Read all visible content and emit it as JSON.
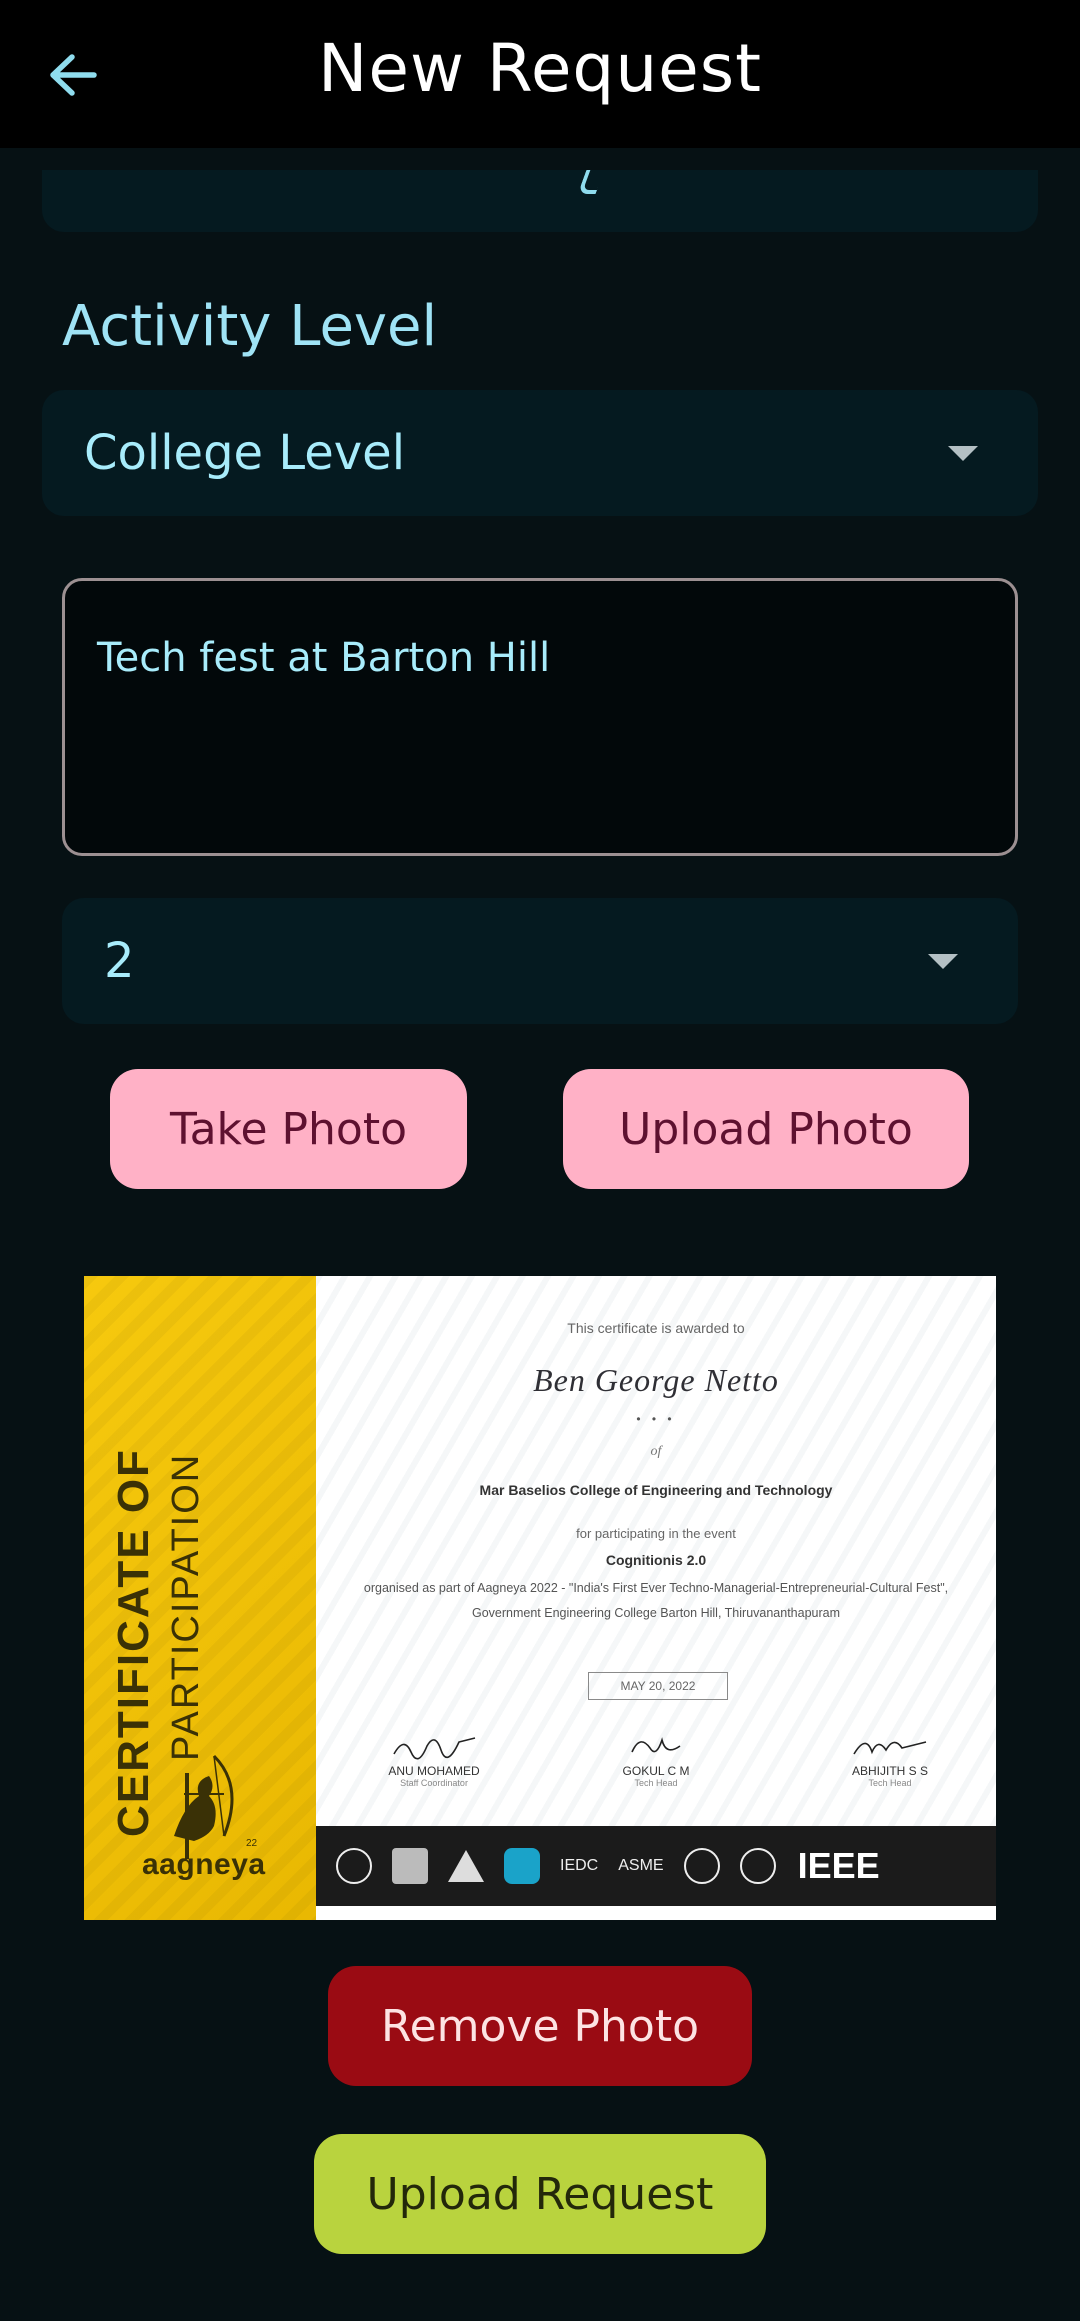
{
  "header": {
    "title": "New Request",
    "back_icon": "arrow-left-icon"
  },
  "form": {
    "activity_level_label": "Activity Level",
    "activity_level_value": "College Level",
    "description_value": "Tech fest at Barton Hill",
    "count_value": "2"
  },
  "buttons": {
    "take_photo": "Take Photo",
    "upload_photo": "Upload Photo",
    "remove_photo": "Remove Photo",
    "upload_request": "Upload Request"
  },
  "certificate": {
    "heading_line1": "CERTIFICATE OF",
    "heading_line2": "PARTICIPATION",
    "brand": "aagneya",
    "brand_sup": "22",
    "awarded_to": "This certificate is awarded to",
    "recipient": "Ben George Netto",
    "ornament": "• • •",
    "of": "of",
    "college": "Mar Baselios College of Engineering and Technology",
    "for_participating": "for participating in the event",
    "event": "Cognitionis 2.0",
    "organised_text": "organised as part of Aagneya 2022 - \"India's First Ever Techno-Managerial-Entrepreneurial-Cultural Fest\", Government Engineering College Barton Hill, Thiruvananthapuram",
    "date": "MAY 20, 2022",
    "signatories": [
      {
        "name": "ANU MOHAMED",
        "role": "Staff Coordinator"
      },
      {
        "name": "GOKUL C M",
        "role": "Tech Head"
      },
      {
        "name": "ABHIJITH S S",
        "role": "Tech Head"
      }
    ],
    "logos": {
      "iedc": "IEDC",
      "asme": "ASME",
      "ieee": "IEEE"
    }
  },
  "colors": {
    "background": "#061114",
    "field": "#051a20",
    "accent_text": "#a8ecfb",
    "pink_button": "#ffb1c6",
    "remove_button": "#9a0b13",
    "upload_button": "#b9d33e"
  }
}
